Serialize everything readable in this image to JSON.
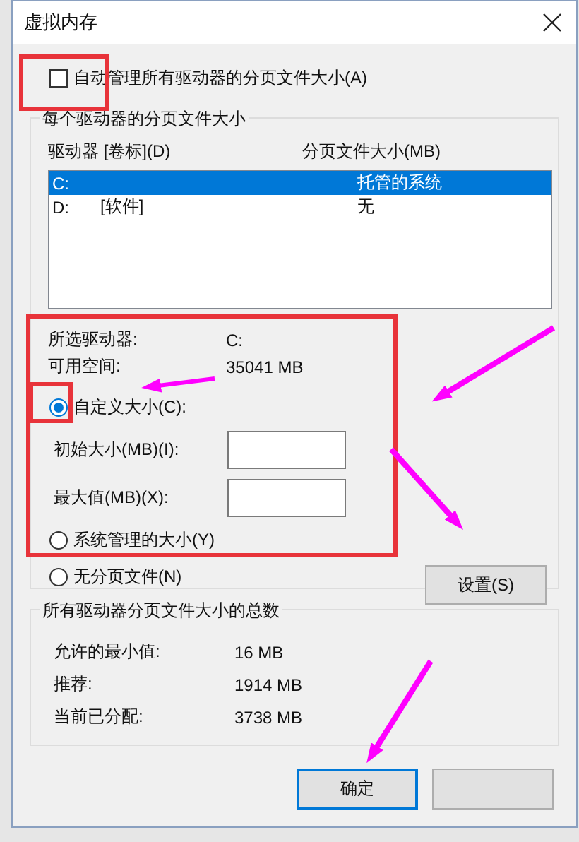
{
  "window": {
    "title": "虚拟内存"
  },
  "auto_manage": {
    "label": "自动管理所有驱动器的分页文件大小(A)",
    "checked": false
  },
  "per_drive": {
    "title": "每个驱动器的分页文件大小",
    "columns": [
      "驱动器 [卷标](D)",
      "分页文件大小(MB)"
    ],
    "rows": [
      {
        "drive": "C:",
        "size": "托管的系统",
        "selected": true
      },
      {
        "drive": "D:",
        "volume": "[软件]",
        "size": "无",
        "selected": false
      }
    ],
    "info": [
      {
        "label": "所选驱动器:",
        "value": "C:"
      },
      {
        "label": "可用空间:",
        "value": "35041 MB"
      }
    ],
    "options": [
      {
        "label": "自定义大小(C):",
        "selected": true
      },
      {
        "label": "系统管理的大小(Y)",
        "selected": false
      },
      {
        "label": "无分页文件(N)",
        "selected": false
      }
    ],
    "fields": [
      {
        "label": "初始大小(MB)(I):"
      },
      {
        "label": "最大值(MB)(X):"
      }
    ],
    "set_button": "设置(S)"
  },
  "totals": {
    "title": "所有驱动器分页文件大小的总数",
    "rows": [
      {
        "label": "允许的最小值:",
        "value": "16 MB"
      },
      {
        "label": "推荐:",
        "value": "1914 MB"
      },
      {
        "label": "当前已分配:",
        "value": "3738 MB"
      }
    ]
  },
  "buttons": [
    {
      "label": "确定",
      "default": true
    },
    {
      "default": false
    }
  ]
}
